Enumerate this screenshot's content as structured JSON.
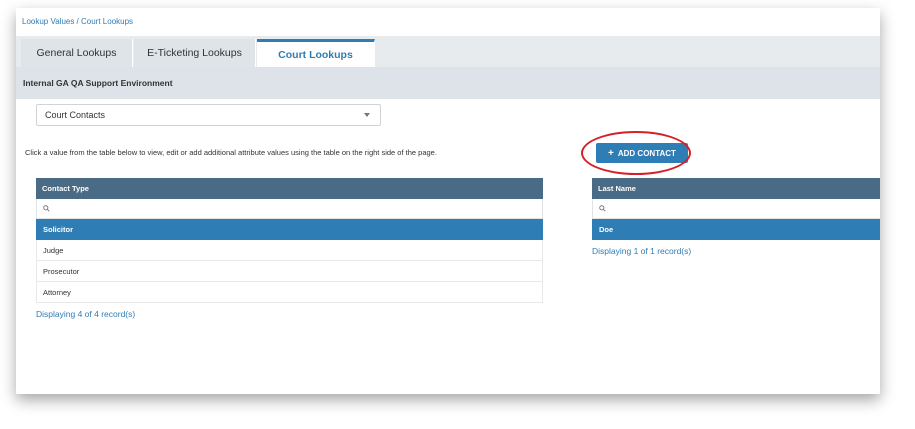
{
  "breadcrumb": "Lookup Values / Court Lookups",
  "tabs": [
    {
      "label": "General Lookups",
      "active": false
    },
    {
      "label": "E-Ticketing Lookups",
      "active": false
    },
    {
      "label": "Court Lookups",
      "active": true
    }
  ],
  "environment": "Internal GA QA Support Environment",
  "lookup_select": {
    "value": "Court Contacts"
  },
  "instructions": "Click a value from the table below to view, edit or add additional attribute values using the table on the right side of the page.",
  "add_button": {
    "icon": "plus-icon",
    "label": "ADD CONTACT"
  },
  "contact_type_table": {
    "header": "Contact Type",
    "rows": [
      "Solicitor",
      "Judge",
      "Prosecutor",
      "Attorney"
    ],
    "selected": "Solicitor",
    "count_text": "Displaying 4 of 4 record(s)"
  },
  "contacts_table": {
    "header": "Last Name",
    "rows": [
      "Doe"
    ],
    "selected": "Doe",
    "count_text": "Displaying 1 of 1 record(s)"
  },
  "colors": {
    "accent": "#2f7db5",
    "table_header": "#4a6b86",
    "highlight_ring": "#d61f26"
  }
}
